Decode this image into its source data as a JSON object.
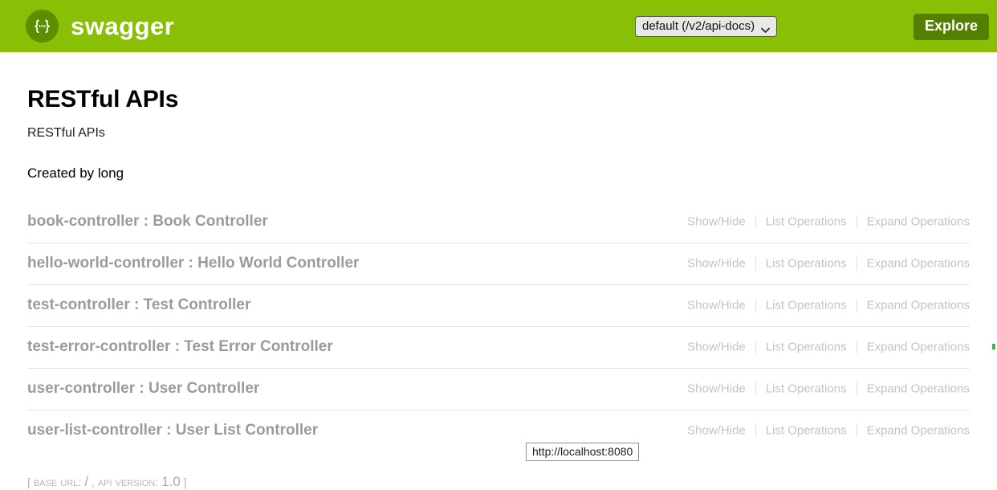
{
  "header": {
    "logo_icon": "swagger-braces-icon",
    "logo_text": "swagger",
    "api_select_value": "default (/v2/api-docs)",
    "api_select_options": [
      "default (/v2/api-docs)"
    ],
    "chevron_icon": "chevron-down-icon",
    "explore_label": "Explore",
    "bar_color": "#89bf04",
    "explore_color": "#547f00"
  },
  "info": {
    "title": "RESTful APIs",
    "description": "RESTful APIs",
    "created_by": "Created by long"
  },
  "ops_labels": {
    "show_hide": "Show/Hide",
    "list_operations": "List Operations",
    "expand_operations": "Expand Operations"
  },
  "resources": [
    {
      "name": "book-controller : Book Controller"
    },
    {
      "name": "hello-world-controller : Hello World Controller"
    },
    {
      "name": "test-controller : Test Controller"
    },
    {
      "name": "test-error-controller : Test Error Controller"
    },
    {
      "name": "user-controller : User Controller"
    },
    {
      "name": "user-list-controller : User List Controller"
    }
  ],
  "footer": {
    "open_bracket": "[",
    "base_url_label": "BASE URL:",
    "base_url_value": "/",
    "comma": ",",
    "api_version_label": "API VERSION:",
    "api_version_value": "1.0",
    "close_bracket": "]"
  },
  "status_bar": {
    "url": "http://localhost:8080"
  }
}
